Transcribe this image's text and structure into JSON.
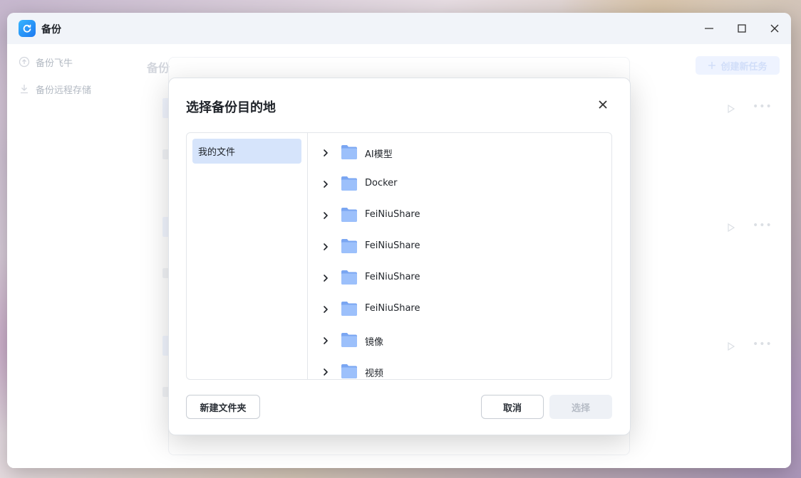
{
  "window": {
    "app_title": "备份",
    "accent_color": "#1e78f0"
  },
  "sidebar": {
    "items": [
      {
        "label": "备份飞牛",
        "icon": "cloud-upload-icon"
      },
      {
        "label": "备份远程存储",
        "icon": "download-icon"
      }
    ]
  },
  "main": {
    "heading": "备份",
    "create_task_label": "创建新任务"
  },
  "dialog": {
    "title": "选择备份目的地",
    "locations": [
      {
        "label": "我的文件",
        "selected": true
      }
    ],
    "folders": [
      {
        "name": "AI模型"
      },
      {
        "name": "Docker"
      },
      {
        "name": "FeiNiuShare"
      },
      {
        "name": "FeiNiuShare"
      },
      {
        "name": "FeiNiuShare"
      },
      {
        "name": "FeiNiuShare"
      },
      {
        "name": "镜像"
      },
      {
        "name": "视频"
      }
    ],
    "new_folder_label": "新建文件夹",
    "cancel_label": "取消",
    "select_label": "选择"
  }
}
